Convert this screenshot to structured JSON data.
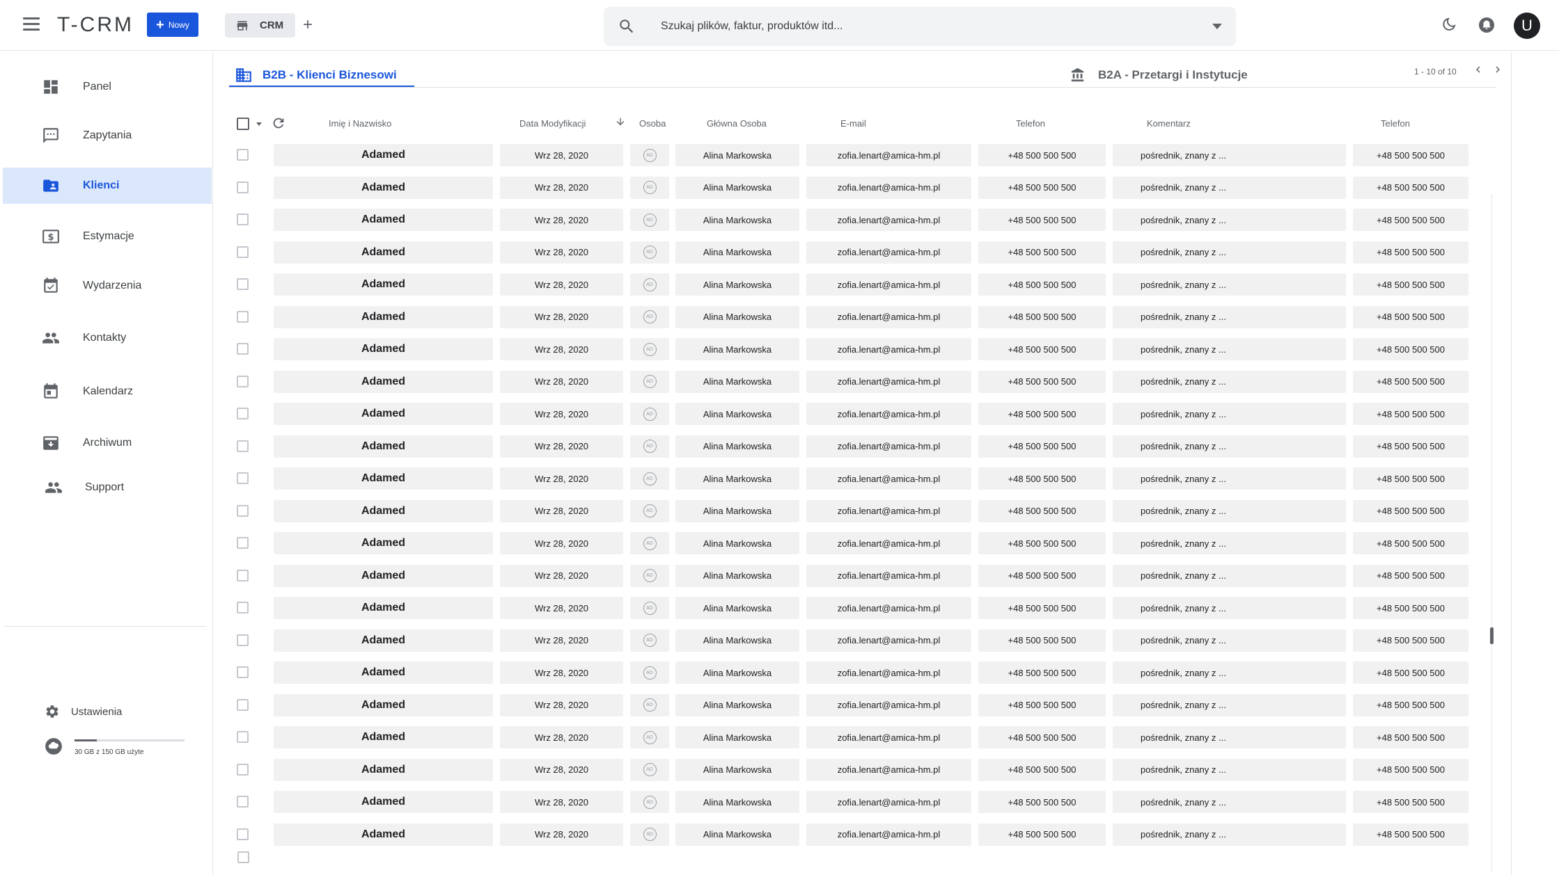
{
  "app": {
    "logo": "T-CRM",
    "new_button": "Nowy",
    "tab_label": "CRM",
    "avatar_initial": "U"
  },
  "search": {
    "placeholder": "Szukaj plików, faktur, produktów itd..."
  },
  "sidebar": {
    "items": [
      {
        "label": "Panel",
        "icon": "dashboard-icon"
      },
      {
        "label": "Zapytania",
        "icon": "chat-icon"
      },
      {
        "label": "Klienci",
        "icon": "folder-user-icon",
        "active": true
      },
      {
        "label": "Estymacje",
        "icon": "dollar-icon"
      },
      {
        "label": "Wydarzenia",
        "icon": "calendar-check-icon"
      },
      {
        "label": "Kontakty",
        "icon": "people-icon"
      },
      {
        "label": "Kalendarz",
        "icon": "calendar-icon"
      },
      {
        "label": "Archiwum",
        "icon": "archive-icon"
      },
      {
        "label": "Support",
        "icon": "support-people-icon"
      }
    ],
    "settings_label": "Ustawienia",
    "storage_text": "30 GB z 150 GB użyte",
    "storage_fraction": 0.2
  },
  "content": {
    "tab_active": "B2B - Klienci Biznesowi",
    "tab_other": "B2A - Przetargi i Instytucje",
    "pager": "1 - 10 of 10",
    "columns": [
      "Imię i Nazwisko",
      "Data Modyfikacji",
      "Osoba",
      "Główna Osoba",
      "E-mail",
      "Telefon",
      "Komentarz",
      "Telefon"
    ],
    "rows": [
      {
        "name": "Adamed",
        "date": "Wrz 28, 2020",
        "person": "AD",
        "main_person": "Alina Markowska",
        "email": "zofia.lenart@amica-hm.pl",
        "phone": "+48 500 500 500",
        "comment": "pośrednik, znany z ...",
        "phone2": "+48 500 500 500"
      },
      {
        "name": "Adamed",
        "date": "Wrz 28, 2020",
        "person": "AD",
        "main_person": "Alina Markowska",
        "email": "zofia.lenart@amica-hm.pl",
        "phone": "+48 500 500 500",
        "comment": "pośrednik, znany z ...",
        "phone2": "+48 500 500 500"
      },
      {
        "name": "Adamed",
        "date": "Wrz 28, 2020",
        "person": "AD",
        "main_person": "Alina Markowska",
        "email": "zofia.lenart@amica-hm.pl",
        "phone": "+48 500 500 500",
        "comment": "pośrednik, znany z ...",
        "phone2": "+48 500 500 500"
      },
      {
        "name": "Adamed",
        "date": "Wrz 28, 2020",
        "person": "AD",
        "main_person": "Alina Markowska",
        "email": "zofia.lenart@amica-hm.pl",
        "phone": "+48 500 500 500",
        "comment": "pośrednik, znany z ...",
        "phone2": "+48 500 500 500"
      },
      {
        "name": "Adamed",
        "date": "Wrz 28, 2020",
        "person": "AD",
        "main_person": "Alina Markowska",
        "email": "zofia.lenart@amica-hm.pl",
        "phone": "+48 500 500 500",
        "comment": "pośrednik, znany z ...",
        "phone2": "+48 500 500 500"
      },
      {
        "name": "Adamed",
        "date": "Wrz 28, 2020",
        "person": "AD",
        "main_person": "Alina Markowska",
        "email": "zofia.lenart@amica-hm.pl",
        "phone": "+48 500 500 500",
        "comment": "pośrednik, znany z ...",
        "phone2": "+48 500 500 500"
      },
      {
        "name": "Adamed",
        "date": "Wrz 28, 2020",
        "person": "AD",
        "main_person": "Alina Markowska",
        "email": "zofia.lenart@amica-hm.pl",
        "phone": "+48 500 500 500",
        "comment": "pośrednik, znany z ...",
        "phone2": "+48 500 500 500"
      },
      {
        "name": "Adamed",
        "date": "Wrz 28, 2020",
        "person": "AD",
        "main_person": "Alina Markowska",
        "email": "zofia.lenart@amica-hm.pl",
        "phone": "+48 500 500 500",
        "comment": "pośrednik, znany z ...",
        "phone2": "+48 500 500 500"
      },
      {
        "name": "Adamed",
        "date": "Wrz 28, 2020",
        "person": "AD",
        "main_person": "Alina Markowska",
        "email": "zofia.lenart@amica-hm.pl",
        "phone": "+48 500 500 500",
        "comment": "pośrednik, znany z ...",
        "phone2": "+48 500 500 500"
      },
      {
        "name": "Adamed",
        "date": "Wrz 28, 2020",
        "person": "AD",
        "main_person": "Alina Markowska",
        "email": "zofia.lenart@amica-hm.pl",
        "phone": "+48 500 500 500",
        "comment": "pośrednik, znany z ...",
        "phone2": "+48 500 500 500"
      },
      {
        "name": "Adamed",
        "date": "Wrz 28, 2020",
        "person": "AD",
        "main_person": "Alina Markowska",
        "email": "zofia.lenart@amica-hm.pl",
        "phone": "+48 500 500 500",
        "comment": "pośrednik, znany z ...",
        "phone2": "+48 500 500 500"
      },
      {
        "name": "Adamed",
        "date": "Wrz 28, 2020",
        "person": "AD",
        "main_person": "Alina Markowska",
        "email": "zofia.lenart@amica-hm.pl",
        "phone": "+48 500 500 500",
        "comment": "pośrednik, znany z ...",
        "phone2": "+48 500 500 500"
      },
      {
        "name": "Adamed",
        "date": "Wrz 28, 2020",
        "person": "AD",
        "main_person": "Alina Markowska",
        "email": "zofia.lenart@amica-hm.pl",
        "phone": "+48 500 500 500",
        "comment": "pośrednik, znany z ...",
        "phone2": "+48 500 500 500"
      },
      {
        "name": "Adamed",
        "date": "Wrz 28, 2020",
        "person": "AD",
        "main_person": "Alina Markowska",
        "email": "zofia.lenart@amica-hm.pl",
        "phone": "+48 500 500 500",
        "comment": "pośrednik, znany z ...",
        "phone2": "+48 500 500 500"
      },
      {
        "name": "Adamed",
        "date": "Wrz 28, 2020",
        "person": "AD",
        "main_person": "Alina Markowska",
        "email": "zofia.lenart@amica-hm.pl",
        "phone": "+48 500 500 500",
        "comment": "pośrednik, znany z ...",
        "phone2": "+48 500 500 500"
      },
      {
        "name": "Adamed",
        "date": "Wrz 28, 2020",
        "person": "AD",
        "main_person": "Alina Markowska",
        "email": "zofia.lenart@amica-hm.pl",
        "phone": "+48 500 500 500",
        "comment": "pośrednik, znany z ...",
        "phone2": "+48 500 500 500"
      },
      {
        "name": "Adamed",
        "date": "Wrz 28, 2020",
        "person": "AD",
        "main_person": "Alina Markowska",
        "email": "zofia.lenart@amica-hm.pl",
        "phone": "+48 500 500 500",
        "comment": "pośrednik, znany z ...",
        "phone2": "+48 500 500 500"
      },
      {
        "name": "Adamed",
        "date": "Wrz 28, 2020",
        "person": "AD",
        "main_person": "Alina Markowska",
        "email": "zofia.lenart@amica-hm.pl",
        "phone": "+48 500 500 500",
        "comment": "pośrednik, znany z ...",
        "phone2": "+48 500 500 500"
      },
      {
        "name": "Adamed",
        "date": "Wrz 28, 2020",
        "person": "AD",
        "main_person": "Alina Markowska",
        "email": "zofia.lenart@amica-hm.pl",
        "phone": "+48 500 500 500",
        "comment": "pośrednik, znany z ...",
        "phone2": "+48 500 500 500"
      },
      {
        "name": "Adamed",
        "date": "Wrz 28, 2020",
        "person": "AD",
        "main_person": "Alina Markowska",
        "email": "zofia.lenart@amica-hm.pl",
        "phone": "+48 500 500 500",
        "comment": "pośrednik, znany z ...",
        "phone2": "+48 500 500 500"
      },
      {
        "name": "Adamed",
        "date": "Wrz 28, 2020",
        "person": "AD",
        "main_person": "Alina Markowska",
        "email": "zofia.lenart@amica-hm.pl",
        "phone": "+48 500 500 500",
        "comment": "pośrednik, znany z ...",
        "phone2": "+48 500 500 500"
      },
      {
        "name": "Adamed",
        "date": "Wrz 28, 2020",
        "person": "AD",
        "main_person": "Alina Markowska",
        "email": "zofia.lenart@amica-hm.pl",
        "phone": "+48 500 500 500",
        "comment": "pośrednik, znany z ...",
        "phone2": "+48 500 500 500"
      }
    ]
  },
  "colors": {
    "accent": "#1a56db",
    "active_bg": "#dbe7fb",
    "cell_bg": "#f1f1f1"
  }
}
